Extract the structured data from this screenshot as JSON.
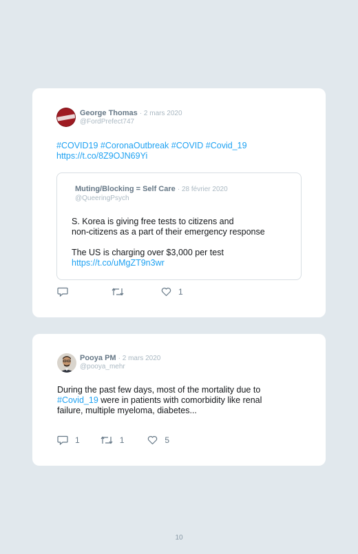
{
  "tweets": [
    {
      "author_name": "George Thomas",
      "date": "· 2 mars 2020",
      "handle": "@FordPrefect747",
      "hashtags": "#COVID19 #CoronaOutbreak #COVID #Covid_19",
      "link": "https://t.co/8Z9OJN69Yi",
      "quoted": {
        "author_name": "Muting/Blocking = Self Care",
        "date": "· 28 février 2020",
        "handle": "@QueeringPsych",
        "line1": "S. Korea is giving free tests to citizens and",
        "line2": "non-citizens as a part of their emergency response",
        "line3": "The US is charging over $3,000 per test",
        "link": "https://t.co/uMgZT9n3wr"
      },
      "actions": {
        "replies": "",
        "retweets": "",
        "likes": "1"
      },
      "avatar_icon": "avatar-red-badge"
    },
    {
      "author_name": "Pooya PM",
      "date": "· 2 mars 2020",
      "handle": "@pooya_mehr",
      "text_line1": "During the past few days, most of the mortality due to",
      "text_hashtag": "#Covid_19",
      "text_line2_rest": " were in patients with comorbidity like renal",
      "text_line3": "failure, multiple myeloma, diabetes...",
      "actions": {
        "replies": "1",
        "retweets": "1",
        "likes": "5"
      },
      "avatar_icon": "avatar-man-photo"
    }
  ],
  "page_number": "10",
  "colors": {
    "background": "#e1e8ed",
    "card": "#ffffff",
    "link": "#1da1f2",
    "meta": "#aab8c2"
  },
  "icons": [
    "reply-icon",
    "retweet-icon",
    "like-icon"
  ]
}
